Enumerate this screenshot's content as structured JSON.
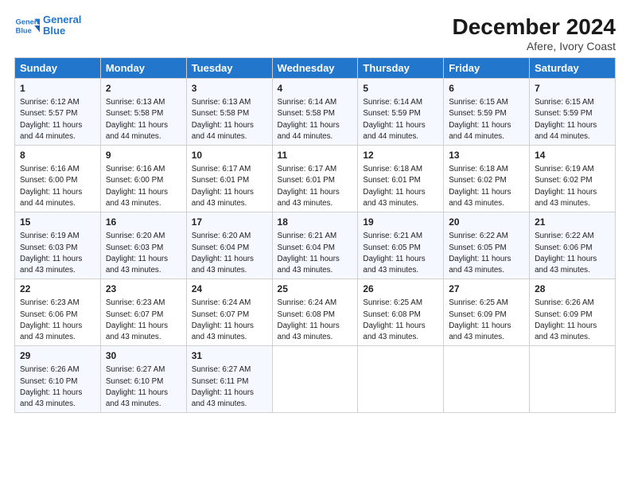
{
  "logo": {
    "line1": "General",
    "line2": "Blue"
  },
  "title": "December 2024",
  "subtitle": "Afere, Ivory Coast",
  "days_of_week": [
    "Sunday",
    "Monday",
    "Tuesday",
    "Wednesday",
    "Thursday",
    "Friday",
    "Saturday"
  ],
  "weeks": [
    [
      {
        "day": "1",
        "sunrise": "Sunrise: 6:12 AM",
        "sunset": "Sunset: 5:57 PM",
        "daylight": "Daylight: 11 hours and 44 minutes."
      },
      {
        "day": "2",
        "sunrise": "Sunrise: 6:13 AM",
        "sunset": "Sunset: 5:58 PM",
        "daylight": "Daylight: 11 hours and 44 minutes."
      },
      {
        "day": "3",
        "sunrise": "Sunrise: 6:13 AM",
        "sunset": "Sunset: 5:58 PM",
        "daylight": "Daylight: 11 hours and 44 minutes."
      },
      {
        "day": "4",
        "sunrise": "Sunrise: 6:14 AM",
        "sunset": "Sunset: 5:58 PM",
        "daylight": "Daylight: 11 hours and 44 minutes."
      },
      {
        "day": "5",
        "sunrise": "Sunrise: 6:14 AM",
        "sunset": "Sunset: 5:59 PM",
        "daylight": "Daylight: 11 hours and 44 minutes."
      },
      {
        "day": "6",
        "sunrise": "Sunrise: 6:15 AM",
        "sunset": "Sunset: 5:59 PM",
        "daylight": "Daylight: 11 hours and 44 minutes."
      },
      {
        "day": "7",
        "sunrise": "Sunrise: 6:15 AM",
        "sunset": "Sunset: 5:59 PM",
        "daylight": "Daylight: 11 hours and 44 minutes."
      }
    ],
    [
      {
        "day": "8",
        "sunrise": "Sunrise: 6:16 AM",
        "sunset": "Sunset: 6:00 PM",
        "daylight": "Daylight: 11 hours and 44 minutes."
      },
      {
        "day": "9",
        "sunrise": "Sunrise: 6:16 AM",
        "sunset": "Sunset: 6:00 PM",
        "daylight": "Daylight: 11 hours and 43 minutes."
      },
      {
        "day": "10",
        "sunrise": "Sunrise: 6:17 AM",
        "sunset": "Sunset: 6:01 PM",
        "daylight": "Daylight: 11 hours and 43 minutes."
      },
      {
        "day": "11",
        "sunrise": "Sunrise: 6:17 AM",
        "sunset": "Sunset: 6:01 PM",
        "daylight": "Daylight: 11 hours and 43 minutes."
      },
      {
        "day": "12",
        "sunrise": "Sunrise: 6:18 AM",
        "sunset": "Sunset: 6:01 PM",
        "daylight": "Daylight: 11 hours and 43 minutes."
      },
      {
        "day": "13",
        "sunrise": "Sunrise: 6:18 AM",
        "sunset": "Sunset: 6:02 PM",
        "daylight": "Daylight: 11 hours and 43 minutes."
      },
      {
        "day": "14",
        "sunrise": "Sunrise: 6:19 AM",
        "sunset": "Sunset: 6:02 PM",
        "daylight": "Daylight: 11 hours and 43 minutes."
      }
    ],
    [
      {
        "day": "15",
        "sunrise": "Sunrise: 6:19 AM",
        "sunset": "Sunset: 6:03 PM",
        "daylight": "Daylight: 11 hours and 43 minutes."
      },
      {
        "day": "16",
        "sunrise": "Sunrise: 6:20 AM",
        "sunset": "Sunset: 6:03 PM",
        "daylight": "Daylight: 11 hours and 43 minutes."
      },
      {
        "day": "17",
        "sunrise": "Sunrise: 6:20 AM",
        "sunset": "Sunset: 6:04 PM",
        "daylight": "Daylight: 11 hours and 43 minutes."
      },
      {
        "day": "18",
        "sunrise": "Sunrise: 6:21 AM",
        "sunset": "Sunset: 6:04 PM",
        "daylight": "Daylight: 11 hours and 43 minutes."
      },
      {
        "day": "19",
        "sunrise": "Sunrise: 6:21 AM",
        "sunset": "Sunset: 6:05 PM",
        "daylight": "Daylight: 11 hours and 43 minutes."
      },
      {
        "day": "20",
        "sunrise": "Sunrise: 6:22 AM",
        "sunset": "Sunset: 6:05 PM",
        "daylight": "Daylight: 11 hours and 43 minutes."
      },
      {
        "day": "21",
        "sunrise": "Sunrise: 6:22 AM",
        "sunset": "Sunset: 6:06 PM",
        "daylight": "Daylight: 11 hours and 43 minutes."
      }
    ],
    [
      {
        "day": "22",
        "sunrise": "Sunrise: 6:23 AM",
        "sunset": "Sunset: 6:06 PM",
        "daylight": "Daylight: 11 hours and 43 minutes."
      },
      {
        "day": "23",
        "sunrise": "Sunrise: 6:23 AM",
        "sunset": "Sunset: 6:07 PM",
        "daylight": "Daylight: 11 hours and 43 minutes."
      },
      {
        "day": "24",
        "sunrise": "Sunrise: 6:24 AM",
        "sunset": "Sunset: 6:07 PM",
        "daylight": "Daylight: 11 hours and 43 minutes."
      },
      {
        "day": "25",
        "sunrise": "Sunrise: 6:24 AM",
        "sunset": "Sunset: 6:08 PM",
        "daylight": "Daylight: 11 hours and 43 minutes."
      },
      {
        "day": "26",
        "sunrise": "Sunrise: 6:25 AM",
        "sunset": "Sunset: 6:08 PM",
        "daylight": "Daylight: 11 hours and 43 minutes."
      },
      {
        "day": "27",
        "sunrise": "Sunrise: 6:25 AM",
        "sunset": "Sunset: 6:09 PM",
        "daylight": "Daylight: 11 hours and 43 minutes."
      },
      {
        "day": "28",
        "sunrise": "Sunrise: 6:26 AM",
        "sunset": "Sunset: 6:09 PM",
        "daylight": "Daylight: 11 hours and 43 minutes."
      }
    ],
    [
      {
        "day": "29",
        "sunrise": "Sunrise: 6:26 AM",
        "sunset": "Sunset: 6:10 PM",
        "daylight": "Daylight: 11 hours and 43 minutes."
      },
      {
        "day": "30",
        "sunrise": "Sunrise: 6:27 AM",
        "sunset": "Sunset: 6:10 PM",
        "daylight": "Daylight: 11 hours and 43 minutes."
      },
      {
        "day": "31",
        "sunrise": "Sunrise: 6:27 AM",
        "sunset": "Sunset: 6:11 PM",
        "daylight": "Daylight: 11 hours and 43 minutes."
      },
      null,
      null,
      null,
      null
    ]
  ]
}
